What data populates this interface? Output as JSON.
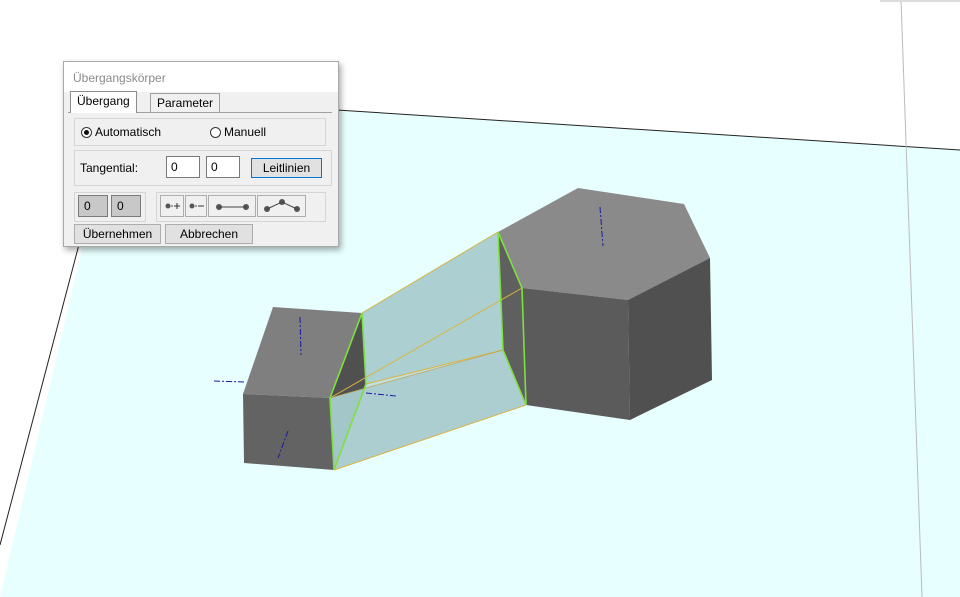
{
  "dialog": {
    "title": "Übergangskörper",
    "tabs": [
      {
        "label": "Übergang",
        "active": true
      },
      {
        "label": "Parameter",
        "active": false
      }
    ],
    "mode": {
      "options": [
        {
          "label": "Automatisch",
          "selected": true
        },
        {
          "label": "Manuell",
          "selected": false
        }
      ]
    },
    "tangential": {
      "label": "Tangential:",
      "value1": "0",
      "value2": "0",
      "button_label": "Leitlinien"
    },
    "counters": [
      "0",
      "0"
    ],
    "point_tools": [
      {
        "icon": "add-point-icon"
      },
      {
        "icon": "remove-point-icon"
      },
      {
        "icon": "line-points-icon"
      },
      {
        "icon": "polyline-points-icon"
      }
    ],
    "buttons": {
      "apply": "Übernehmen",
      "cancel": "Abbrechen"
    }
  },
  "scene": {
    "ground_color": "#e8ffff",
    "box_color_top": "#8a8a8a",
    "transition_color": "#a9cdcf",
    "edge_highlight": "#7ee040"
  }
}
